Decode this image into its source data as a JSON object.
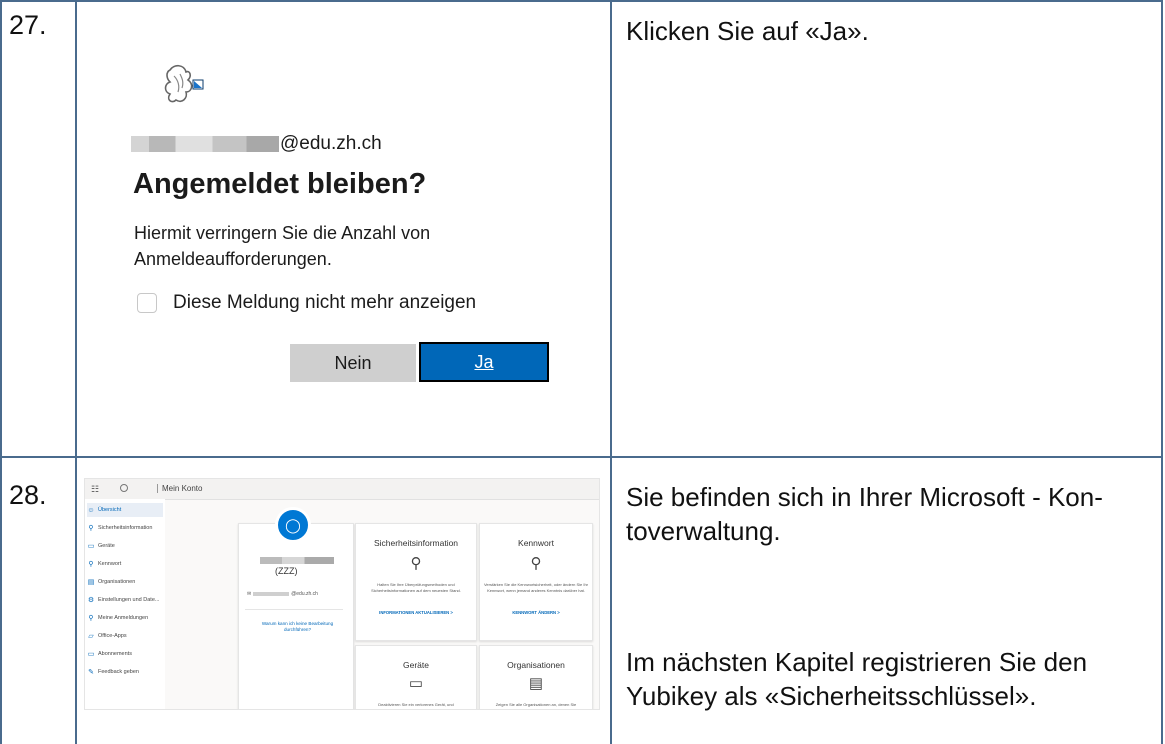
{
  "rows": [
    {
      "number": "27.",
      "instruction": "Klicken Sie auf «Ja»."
    },
    {
      "number": "28.",
      "instruction_1": "Sie befinden sich in Ihrer Microsoft - Kon-",
      "instruction_2": "toverwaltung.",
      "instruction_3": "Im nächsten Kapitel registrieren Sie den",
      "instruction_4": "Yubikey als «Sicherheitsschlüssel»."
    }
  ],
  "login": {
    "email_domain": "@edu.zh.ch",
    "title": "Angemeldet bleiben?",
    "desc_line1": "Hiermit verringern Sie die Anzahl von",
    "desc_line2": "Anmeldeaufforderungen.",
    "checkbox_label": "Diese Meldung nicht mehr anzeigen",
    "btn_no": "Nein",
    "btn_yes": "Ja",
    "accent_color": "#0067b8"
  },
  "account": {
    "header": "Mein Konto",
    "sidebar": [
      {
        "label": "Übersicht",
        "icon": "person-icon",
        "active": true
      },
      {
        "label": "Sicherheitsinformation",
        "icon": "security-info-icon"
      },
      {
        "label": "Geräte",
        "icon": "laptop-icon"
      },
      {
        "label": "Kennwort",
        "icon": "key-icon"
      },
      {
        "label": "Organisationen",
        "icon": "briefcase-icon"
      },
      {
        "label": "Einstellungen und Date...",
        "icon": "gear-icon"
      },
      {
        "label": "Meine Anmeldungen",
        "icon": "signin-icon"
      },
      {
        "label": "Office-Apps",
        "icon": "office-icon"
      },
      {
        "label": "Abonnements",
        "icon": "card-icon"
      },
      {
        "label": "Feedback geben",
        "icon": "feedback-icon"
      }
    ],
    "profile": {
      "avatar_glyph": "person-icon",
      "name_suffix": "(ZZZ)",
      "email_domain": "@edu.zh.ch",
      "link": "Warum kann ich keine Bearbeitung durchführen?"
    },
    "cards": [
      {
        "title": "Sicherheitsinformation",
        "icon": "security-info-icon",
        "text": "Halten Sie Ihre Überprüfungsmethoden und Sicherheitsinformationen auf dem neuesten Stand.",
        "link": "INFORMATIONEN AKTUALISIEREN >"
      },
      {
        "title": "Kennwort",
        "icon": "key-icon",
        "text": "Verstärken Sie die Kennwortsicherheit, oder ändern Sie Ihr Kennwort, wenn jemand anderes Kenntnis darüber hat.",
        "link": "KENNWORT ÄNDERN >"
      },
      {
        "title": "Geräte",
        "icon": "laptop-icon",
        "text": "Deaktivieren Sie ein verlorenes Gerät, und"
      },
      {
        "title": "Organisationen",
        "icon": "briefcase-icon",
        "text": "Zeigen Sie alle Organisationen an, denen Sie"
      }
    ]
  }
}
